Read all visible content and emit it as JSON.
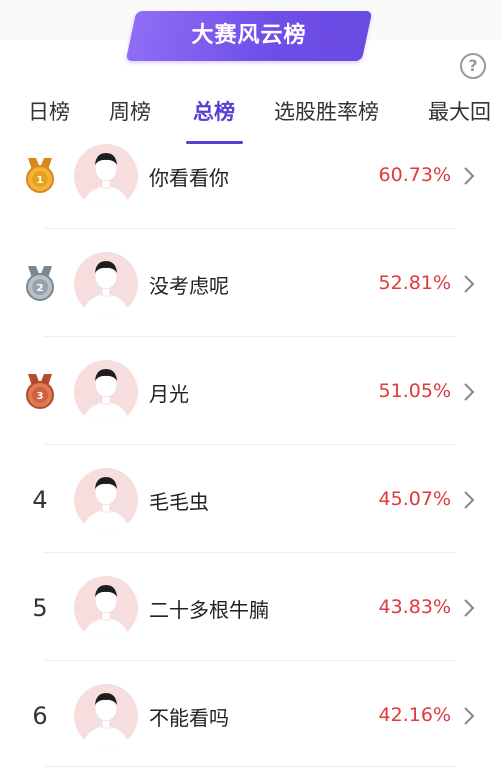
{
  "header": {
    "title": "大赛风云榜"
  },
  "tabs": [
    {
      "label": "日榜",
      "active": false
    },
    {
      "label": "周榜",
      "active": false
    },
    {
      "label": "总榜",
      "active": true
    },
    {
      "label": "选股胜率榜",
      "active": false
    },
    {
      "label": "最大回"
    }
  ],
  "ranking": [
    {
      "rank": "1",
      "medal": "gold-medal-icon",
      "name": "你看看你",
      "rate": "60.73%"
    },
    {
      "rank": "2",
      "medal": "silver-medal-icon",
      "name": "没考虑呢",
      "rate": "52.81%"
    },
    {
      "rank": "3",
      "medal": "bronze-medal-icon",
      "name": "月光",
      "rate": "51.05%"
    },
    {
      "rank": "4",
      "name": "毛毛虫",
      "rate": "45.07%"
    },
    {
      "rank": "5",
      "name": "二十多根牛腩",
      "rate": "43.83%"
    },
    {
      "rank": "6",
      "name": "不能看吗",
      "rate": "42.16%"
    }
  ],
  "colors": {
    "accent": "#5b3ed6",
    "rate": "#e03a3a",
    "gold": "#e6a11f",
    "silver": "#9aa3ad",
    "bronze": "#d0613d"
  }
}
